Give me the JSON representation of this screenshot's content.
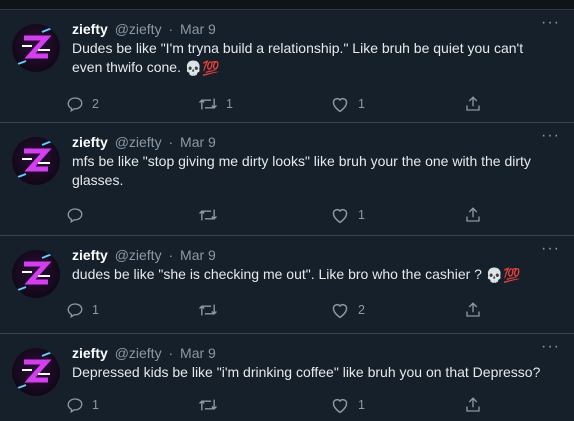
{
  "tweets": [
    {
      "name": "ziefty",
      "handle": "@ziefty",
      "sep": "·",
      "date": "Mar 9",
      "more": "···",
      "text": "Dudes be like \"I'm tryna build a relationship.\" Like bruh be quiet you can't even thwifo cone.",
      "emojis": "💀💯",
      "reply_count": "2",
      "retweet_count": "1",
      "like_count": "1"
    },
    {
      "name": "ziefty",
      "handle": "@ziefty",
      "sep": "·",
      "date": "Mar 9",
      "more": "···",
      "text": "mfs be like \"stop giving me dirty looks\" like bruh your the one with the dirty glasses.",
      "emojis": "",
      "reply_count": "",
      "retweet_count": "",
      "like_count": "1"
    },
    {
      "name": "ziefty",
      "handle": "@ziefty",
      "sep": "·",
      "date": "Mar 9",
      "more": "···",
      "text": "dudes be like \"she is checking me out\". Like bro who the cashier ?",
      "emojis": "💀💯",
      "reply_count": "1",
      "retweet_count": "",
      "like_count": "2"
    },
    {
      "name": "ziefty",
      "handle": "@ziefty",
      "sep": "·",
      "date": "Mar 9",
      "more": "···",
      "text": "Depressed kids be like \"i'm drinking coffee\" like bruh you on that Depresso?",
      "emojis": "",
      "reply_count": "1",
      "retweet_count": "",
      "like_count": "1"
    }
  ],
  "icons": {
    "reply": "reply-icon",
    "retweet": "retweet-icon",
    "like": "heart-icon",
    "share": "share-icon"
  },
  "colors": {
    "background": "#15202b",
    "divider": "#38444d",
    "muted": "#8b98a5",
    "avatar_accent": "#d63cf2"
  }
}
